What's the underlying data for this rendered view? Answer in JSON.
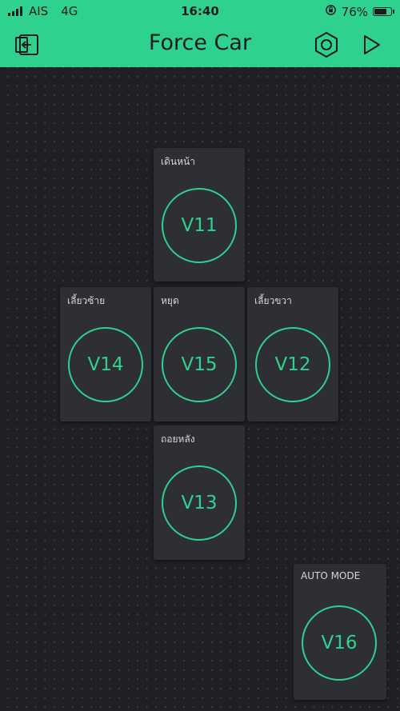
{
  "status_bar": {
    "carrier": "AIS",
    "network": "4G",
    "time": "16:40",
    "battery": "76%"
  },
  "header": {
    "title": "Force Car"
  },
  "colors": {
    "accent": "#2fd18f",
    "background": "#1f2024",
    "widget": "#2e2f34"
  },
  "buttons": [
    {
      "label": "เดินหน้า",
      "pin": "V11"
    },
    {
      "label": "เลี้ยวซ้าย",
      "pin": "V14"
    },
    {
      "label": "หยุด",
      "pin": "V15"
    },
    {
      "label": "เลี้ยวขวา",
      "pin": "V12"
    },
    {
      "label": "ถอยหลัง",
      "pin": "V13"
    },
    {
      "label": "AUTO MODE",
      "pin": "V16"
    }
  ]
}
